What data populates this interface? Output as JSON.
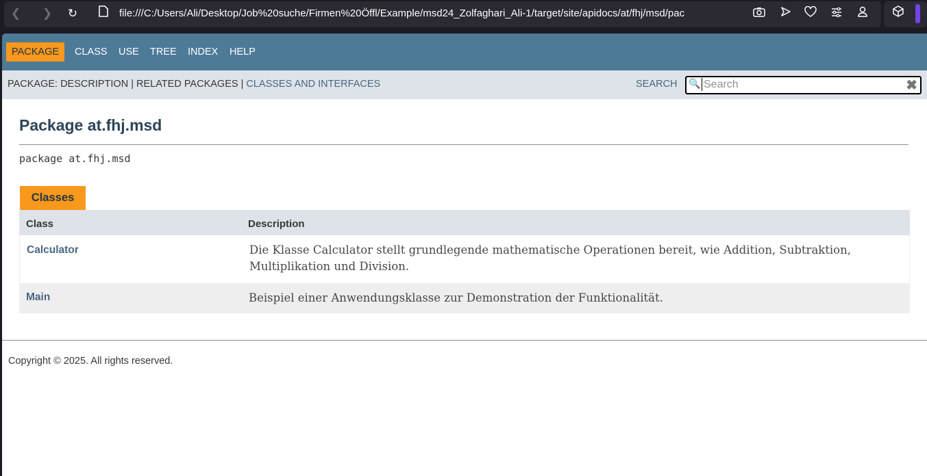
{
  "browser": {
    "url": "file:///C:/Users/Ali/Desktop/Job%20suche/Firmen%20Öffl/Example/msd24_Zolfaghari_Ali-1/target/site/apidocs/at/fhj/msd/pac",
    "icons": [
      "back-icon",
      "forward-icon",
      "reload-icon",
      "file-icon",
      "screenshot-icon",
      "send-icon",
      "heart-icon",
      "sliders-icon",
      "account-icon",
      "extension-icon"
    ]
  },
  "topnav": {
    "package": "PACKAGE",
    "class": "CLASS",
    "use": "USE",
    "tree": "TREE",
    "index": "INDEX",
    "help": "HELP"
  },
  "subnav": {
    "prefix": "PACKAGE: DESCRIPTION | RELATED PACKAGES | ",
    "classes_link": "CLASSES AND INTERFACES",
    "search_label": "SEARCH",
    "search_placeholder": "Search",
    "reset_glyph": "✖"
  },
  "main": {
    "title": "Package at.fhj.msd",
    "signature": "package at.fhj.msd",
    "tab_label": "Classes",
    "table": {
      "headers": {
        "class": "Class",
        "description": "Description"
      },
      "rows": [
        {
          "name": "Calculator",
          "description": "Die Klasse Calculator stellt grundlegende mathematische Operationen bereit, wie Addition, Subtraktion, Multiplikation und Division."
        },
        {
          "name": "Main",
          "description": "Beispiel einer Anwendungsklasse zur Demonstration der Funktionalität."
        }
      ]
    }
  },
  "footer": {
    "copyright": "Copyright © 2025. All rights reserved."
  },
  "colors": {
    "nav_bg": "#4d7a97",
    "active_tab": "#f8981d",
    "subnav_bg": "#dee3e9",
    "link": "#4a6782",
    "title": "#2c4557"
  }
}
